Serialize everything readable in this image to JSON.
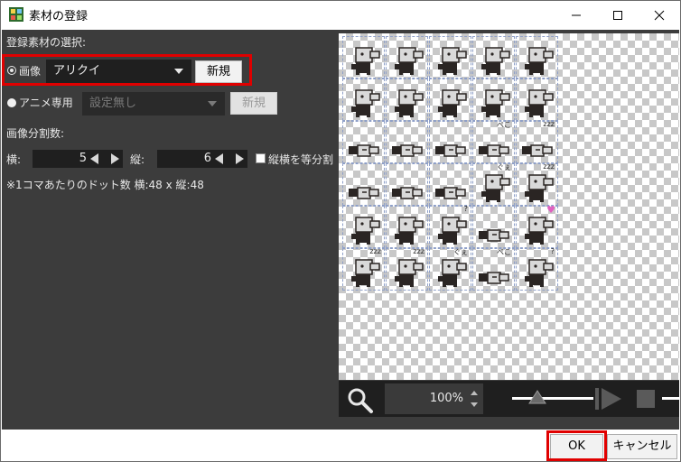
{
  "window": {
    "title": "素材の登録"
  },
  "left": {
    "section_label": "登録素材の選択:",
    "image_radio_label": "画像",
    "image_combo_value": "アリクイ",
    "image_new_button": "新規",
    "anime_radio_label": "アニメ専用",
    "anime_combo_value": "設定無し",
    "anime_new_button": "新規",
    "split_label": "画像分割数:",
    "horizontal_label": "横:",
    "horizontal_value": "5",
    "vertical_label": "縦:",
    "vertical_value": "6",
    "equal_split_label": "縦横を等分割",
    "dot_info": "※1コマあたりのドット数 横:48 x 縦:48"
  },
  "preview": {
    "zoom_value": "100%",
    "annotations": {
      "zzz": "zzz",
      "bow": "ぺこ",
      "ugh": "ぐぇ",
      "question": "?"
    }
  },
  "footer": {
    "ok_label": "OK",
    "cancel_label": "キャンセル"
  },
  "colors": {
    "highlight": "#e00000",
    "panel": "#3c3c3c",
    "heart": "#e060c0"
  }
}
